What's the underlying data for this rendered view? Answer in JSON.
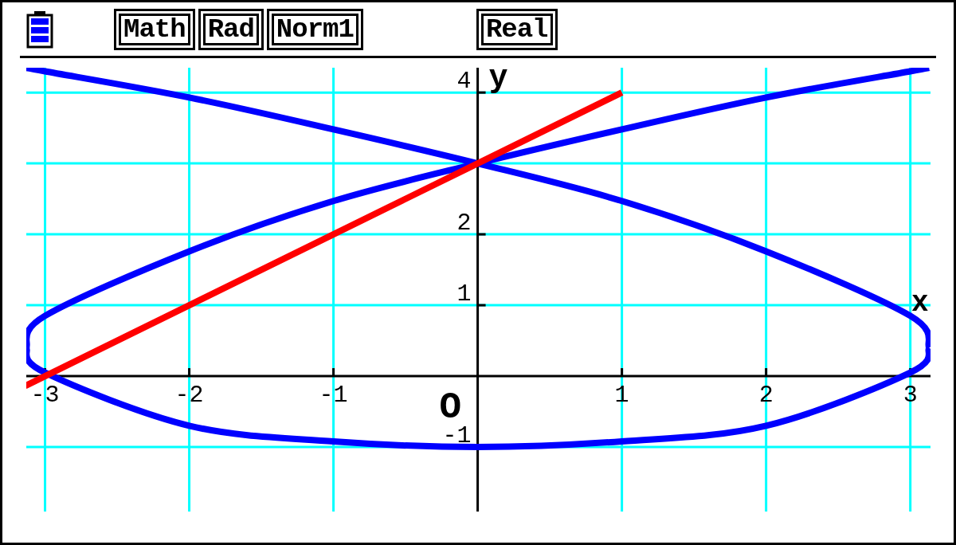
{
  "status_bar": {
    "badges": [
      "Math",
      "Rad",
      "Norm1"
    ],
    "right_badges": [
      "Real"
    ]
  },
  "graph": {
    "origin_label": "O",
    "chart_data": {
      "type": "line",
      "grid": true,
      "xlabel": "x",
      "ylabel": "y",
      "x": [
        -3.13,
        -3,
        -2,
        -1,
        0,
        1,
        2,
        3,
        3.13
      ],
      "series": [
        {
          "color": "#0000ff",
          "values": [
            4.35,
            4.3,
            3.93,
            3.48,
            3,
            2.47,
            1.76,
            0.85,
            0.4
          ]
        },
        {
          "color": "#0000ff",
          "values": [
            0.4,
            0.85,
            1.76,
            2.47,
            3,
            3.48,
            3.93,
            4.3,
            4.35
          ]
        },
        {
          "color": "#0000ff",
          "values": [
            0.4,
            0.05,
            -0.7,
            -0.92,
            -1,
            -0.92,
            -0.7,
            0.05,
            0.4
          ]
        },
        {
          "color": "#ff0000",
          "values": [
            -0.13,
            0,
            1,
            2,
            3,
            4,
            null,
            null,
            null
          ]
        }
      ],
      "xlim": [
        -3.13,
        3.14
      ],
      "ylim": [
        -1.91,
        4.35
      ],
      "xticks": [
        -3,
        -2,
        -1,
        1,
        2,
        3
      ],
      "yticks": [
        -1,
        1,
        2,
        4
      ]
    }
  }
}
